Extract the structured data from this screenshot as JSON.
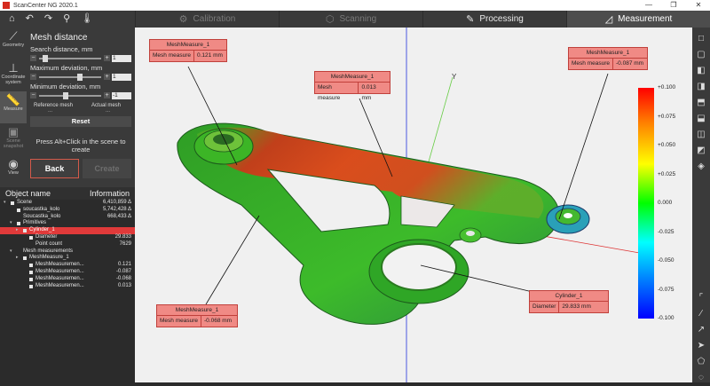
{
  "window": {
    "title": "ScanCenter NG 2020.1",
    "controls": {
      "min": "—",
      "max": "❐",
      "close": "✕"
    }
  },
  "toolbar": {
    "quick": [
      {
        "icon": "home-icon",
        "glyph": "⌂"
      },
      {
        "icon": "undo-icon",
        "glyph": "↶"
      },
      {
        "icon": "redo-icon",
        "glyph": "↷"
      },
      {
        "icon": "pin-icon",
        "glyph": "⚲"
      },
      {
        "icon": "thermometer-icon",
        "glyph": "🌡"
      }
    ],
    "tabs": [
      {
        "label": "Calibration",
        "icon": "gear-icon",
        "glyph": "⚙",
        "state": "disabled"
      },
      {
        "label": "Scanning",
        "icon": "cube-icon",
        "glyph": "⬡",
        "state": "disabled"
      },
      {
        "label": "Processing",
        "icon": "pencil-icon",
        "glyph": "✎",
        "state": "enabled"
      },
      {
        "label": "Measurement",
        "icon": "ruler-icon",
        "glyph": "◿",
        "state": "active"
      }
    ]
  },
  "left_tools": [
    {
      "label": "Geometry",
      "glyph": "⟋",
      "state": "normal"
    },
    {
      "label": "Coordinate system",
      "glyph": "⊥",
      "state": "normal"
    },
    {
      "label": "Measure",
      "glyph": "📏",
      "state": "active"
    },
    {
      "label": "Scene snapshot",
      "glyph": "▣",
      "state": "dim"
    },
    {
      "label": "View",
      "glyph": "◉",
      "state": "normal"
    }
  ],
  "panel": {
    "title": "Mesh distance",
    "search_label": "Search distance, mm",
    "search_value": "1",
    "max_label": "Maximum deviation, mm",
    "max_value": "1",
    "min_label": "Minimum deviation, mm",
    "min_value": "-1",
    "ref_mesh_label": "Reference mesh",
    "act_mesh_label": "Actual mesh",
    "ref_mesh_value": "...",
    "act_mesh_value": "...",
    "reset_label": "Reset",
    "hint": "Press Alt+Click in the scene to create",
    "back_label": "Back",
    "create_label": "Create"
  },
  "tree": {
    "col_name": "Object name",
    "col_info": "Information",
    "rows": [
      {
        "name": "Scene",
        "info": "6,410,859 Δ",
        "indent": 0,
        "arrow": "▾",
        "sq": true
      },
      {
        "name": "soucastka_kolo",
        "info": "5,742,428 Δ",
        "indent": 1,
        "arrow": "",
        "sq": true
      },
      {
        "name": "Soucastka_kolo",
        "info": "668,433 Δ",
        "indent": 1,
        "arrow": "",
        "sq": false
      },
      {
        "name": "Primitives",
        "info": "",
        "indent": 1,
        "arrow": "▾",
        "sq": true
      },
      {
        "name": "Cylinder_1",
        "info": "",
        "indent": 2,
        "arrow": "▸",
        "sq": true,
        "selected": true
      },
      {
        "name": "Diameter",
        "info": "29.833",
        "indent": 3,
        "arrow": "",
        "sq": true
      },
      {
        "name": "Point count",
        "info": "7629",
        "indent": 3,
        "arrow": "",
        "sq": false
      },
      {
        "name": "Mesh measurements",
        "info": "",
        "indent": 1,
        "arrow": "▾",
        "sq": false
      },
      {
        "name": "MeshMeasure_1",
        "info": "",
        "indent": 2,
        "arrow": "▸",
        "sq": true
      },
      {
        "name": "MeshMeasuremen...",
        "info": "0.121",
        "indent": 3,
        "arrow": "",
        "sq": true
      },
      {
        "name": "MeshMeasuremen...",
        "info": "-0.087",
        "indent": 3,
        "arrow": "",
        "sq": true
      },
      {
        "name": "MeshMeasuremen...",
        "info": "-0.068",
        "indent": 3,
        "arrow": "",
        "sq": true
      },
      {
        "name": "MeshMeasuremen...",
        "info": "0.013",
        "indent": 3,
        "arrow": "",
        "sq": true
      }
    ]
  },
  "viewport": {
    "axis_label": "Y",
    "callouts": [
      {
        "title": "MeshMeasure_1",
        "field": "Mesh measure",
        "value": "0.121 mm"
      },
      {
        "title": "MeshMeasure_1",
        "field": "Mesh measure",
        "value": "0.013 mm"
      },
      {
        "title": "MeshMeasure_1",
        "field": "Mesh measure",
        "value": "-0.087 mm"
      },
      {
        "title": "MeshMeasure_1",
        "field": "Mesh measure",
        "value": "-0.068 mm"
      },
      {
        "title": "Cylinder_1",
        "field": "Diameter",
        "value": "29.833 mm"
      }
    ],
    "scale_ticks": [
      "+0.100",
      "+0.075",
      "+0.050",
      "+0.025",
      "0.000",
      "-0.025",
      "-0.050",
      "-0.075",
      "-0.100"
    ]
  },
  "right_tools": [
    {
      "icon": "view-front-icon",
      "glyph": "□"
    },
    {
      "icon": "view-back-icon",
      "glyph": "▢"
    },
    {
      "icon": "view-left-icon",
      "glyph": "◧"
    },
    {
      "icon": "view-right-icon",
      "glyph": "◨"
    },
    {
      "icon": "view-top-icon",
      "glyph": "⬒"
    },
    {
      "icon": "view-bottom-icon",
      "glyph": "⬓"
    },
    {
      "icon": "view-iso-icon",
      "glyph": "◫"
    },
    {
      "icon": "view-mode-icon",
      "glyph": "◩"
    },
    {
      "icon": "palette-icon",
      "glyph": "◈"
    }
  ],
  "right_tools_bottom": [
    {
      "icon": "corner-icon",
      "glyph": "⌜"
    },
    {
      "icon": "brush-icon",
      "glyph": "∕"
    },
    {
      "icon": "select-icon",
      "glyph": "↗"
    },
    {
      "icon": "cursor-icon",
      "glyph": "➤"
    },
    {
      "icon": "polygon-icon",
      "glyph": "⬠"
    },
    {
      "icon": "lasso-icon",
      "glyph": "◌"
    }
  ]
}
